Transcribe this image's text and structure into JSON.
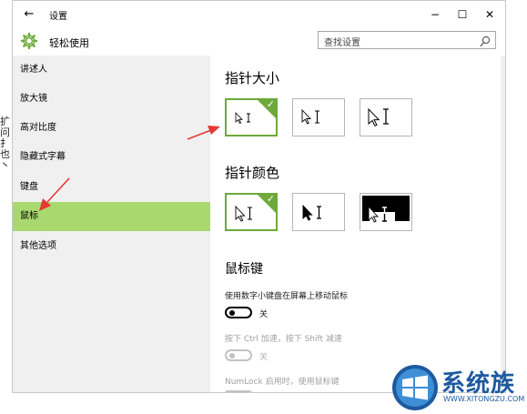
{
  "window": {
    "title": "设置",
    "back_glyph": "←",
    "minimize_glyph": "−",
    "maximize_glyph": "☐",
    "close_glyph": "✕"
  },
  "header": {
    "title": "轻松使用",
    "search_placeholder": "查找设置",
    "icon": "gear-icon"
  },
  "background_scraps": [
    "扩",
    "问",
    "扌",
    "也",
    "丶"
  ],
  "sidebar": {
    "items": [
      {
        "label": "讲述人",
        "active": false
      },
      {
        "label": "放大镜",
        "active": false
      },
      {
        "label": "高对比度",
        "active": false
      },
      {
        "label": "隐藏式字幕",
        "active": false
      },
      {
        "label": "键盘",
        "active": false
      },
      {
        "label": "鼠标",
        "active": true
      },
      {
        "label": "其他选项",
        "active": false
      }
    ]
  },
  "main": {
    "pointer_size_title": "指针大小",
    "pointer_color_title": "指针颜色",
    "mouse_keys_title": "鼠标键",
    "mouse_keys_desc": "使用数字小键盘在屏幕上移动鼠标",
    "mouse_keys_toggle": "关",
    "ctrl_shift_desc": "按下 Ctrl 加速，按下 Shift 减速",
    "ctrl_shift_toggle": "关",
    "numlock_desc": "NumLock 启用时，使用鼠标键"
  },
  "pointer_size_options": [
    "small",
    "medium",
    "large"
  ],
  "pointer_size_selected": 0,
  "pointer_color_options": [
    "white",
    "black",
    "inverted"
  ],
  "pointer_color_selected": 0,
  "colors": {
    "accent_green": "#6ea93b",
    "sidebar_active": "#a9d86e",
    "annotation_red": "#e53935"
  },
  "watermark": {
    "text": "系统族",
    "url": "WWW.XITONGZU.COM"
  }
}
